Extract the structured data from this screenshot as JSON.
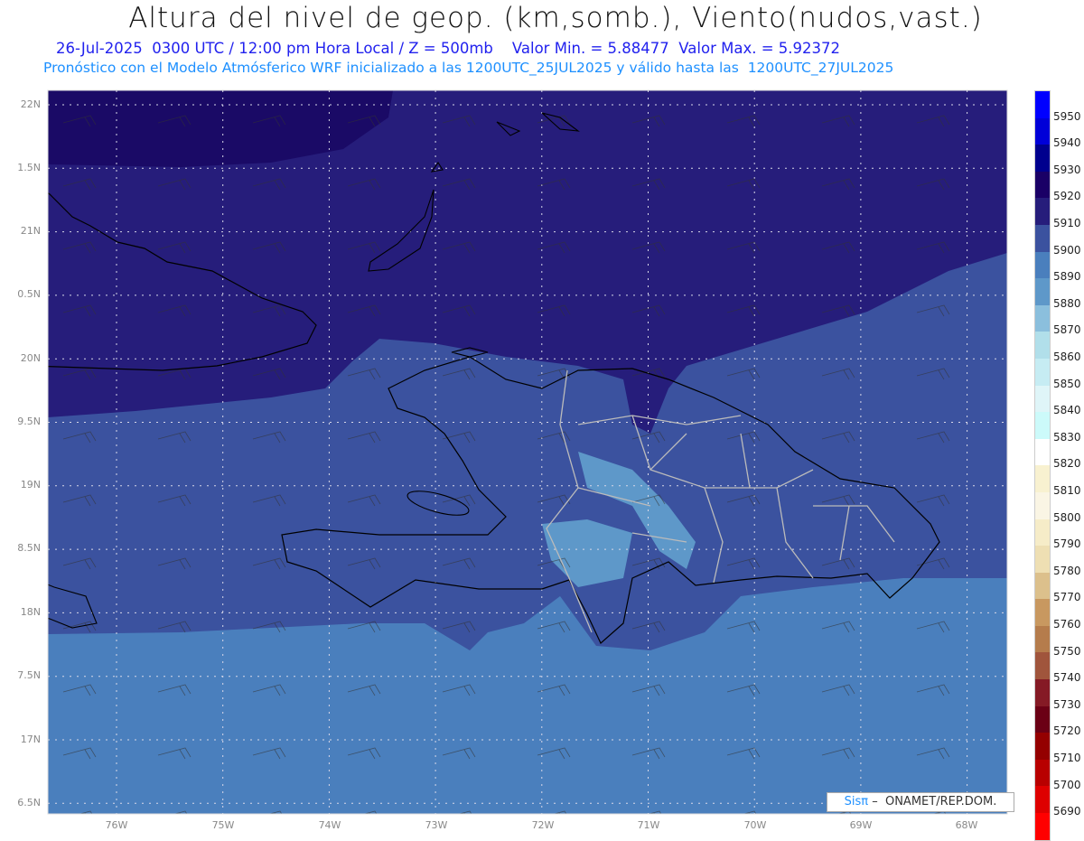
{
  "header": {
    "title": "Altura del nivel de geop. (km,somb.), Viento(nudos,vast.)",
    "subtitle": "26-Jul-2025  0300 UTC / 12:00 pm Hora Local / Z = 500mb    Valor Min. = 5.88477  Valor Max. = 5.92372",
    "info": "Pronóstico con el Modelo Atmósferico WRF inicializado a las 1200UTC_25JUL2025 y válido hasta las  1200UTC_27JUL2025"
  },
  "axes": {
    "lat_labels": [
      "22N",
      "1.5N",
      "21N",
      "0.5N",
      "20N",
      "9.5N",
      "19N",
      "8.5N",
      "18N",
      "7.5N",
      "17N",
      "6.5N"
    ],
    "lon_labels": [
      "76W",
      "75W",
      "74W",
      "73W",
      "72W",
      "71W",
      "70W",
      "69W",
      "68W"
    ]
  },
  "colorbar": {
    "labels": [
      "5950",
      "5940",
      "5930",
      "5920",
      "5910",
      "5900",
      "5890",
      "5880",
      "5870",
      "5860",
      "5850",
      "5840",
      "5830",
      "5820",
      "5810",
      "5800",
      "5790",
      "5780",
      "5770",
      "5760",
      "5750",
      "5740",
      "5730",
      "5720",
      "5710",
      "5700",
      "5690"
    ],
    "colors": [
      "#0000ff",
      "#0000d8",
      "#00008e",
      "#1a0066",
      "#261d7b",
      "#3b529f",
      "#4a7fbd",
      "#5e98c9",
      "#8bbfdd",
      "#b1dfea",
      "#c6ecf3",
      "#dff5f8",
      "#ccfafa",
      "#ffffff",
      "#f8f1d0",
      "#faf5e4",
      "#f6ecc8",
      "#eedfb3",
      "#dcc08c",
      "#c89860",
      "#b57c4c",
      "#a0553c",
      "#851a25",
      "#6b0015",
      "#940000",
      "#b80000",
      "#de0000",
      "#ff0000"
    ]
  },
  "credit": {
    "brand": "Sisπ",
    "text": " –  ONAMET/REP.DOM."
  }
}
